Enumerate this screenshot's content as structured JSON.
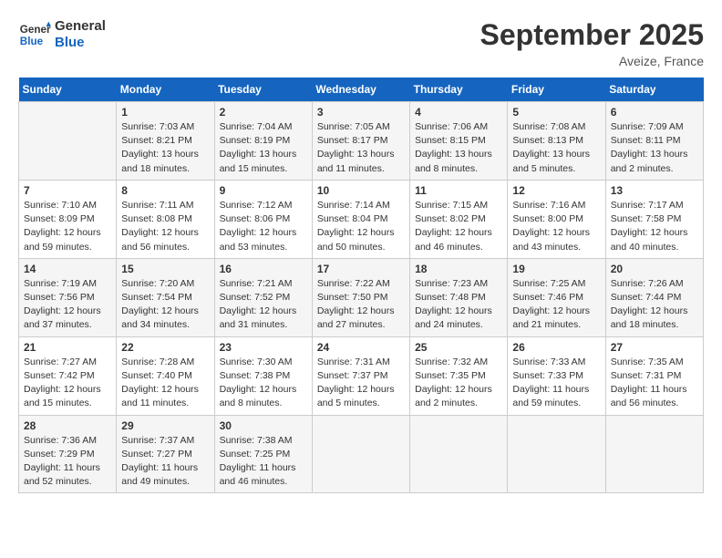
{
  "logo": {
    "line1": "General",
    "line2": "Blue"
  },
  "title": "September 2025",
  "location": "Aveize, France",
  "days_of_week": [
    "Sunday",
    "Monday",
    "Tuesday",
    "Wednesday",
    "Thursday",
    "Friday",
    "Saturday"
  ],
  "weeks": [
    [
      {
        "day": "",
        "info": ""
      },
      {
        "day": "1",
        "info": "Sunrise: 7:03 AM\nSunset: 8:21 PM\nDaylight: 13 hours\nand 18 minutes."
      },
      {
        "day": "2",
        "info": "Sunrise: 7:04 AM\nSunset: 8:19 PM\nDaylight: 13 hours\nand 15 minutes."
      },
      {
        "day": "3",
        "info": "Sunrise: 7:05 AM\nSunset: 8:17 PM\nDaylight: 13 hours\nand 11 minutes."
      },
      {
        "day": "4",
        "info": "Sunrise: 7:06 AM\nSunset: 8:15 PM\nDaylight: 13 hours\nand 8 minutes."
      },
      {
        "day": "5",
        "info": "Sunrise: 7:08 AM\nSunset: 8:13 PM\nDaylight: 13 hours\nand 5 minutes."
      },
      {
        "day": "6",
        "info": "Sunrise: 7:09 AM\nSunset: 8:11 PM\nDaylight: 13 hours\nand 2 minutes."
      }
    ],
    [
      {
        "day": "7",
        "info": "Sunrise: 7:10 AM\nSunset: 8:09 PM\nDaylight: 12 hours\nand 59 minutes."
      },
      {
        "day": "8",
        "info": "Sunrise: 7:11 AM\nSunset: 8:08 PM\nDaylight: 12 hours\nand 56 minutes."
      },
      {
        "day": "9",
        "info": "Sunrise: 7:12 AM\nSunset: 8:06 PM\nDaylight: 12 hours\nand 53 minutes."
      },
      {
        "day": "10",
        "info": "Sunrise: 7:14 AM\nSunset: 8:04 PM\nDaylight: 12 hours\nand 50 minutes."
      },
      {
        "day": "11",
        "info": "Sunrise: 7:15 AM\nSunset: 8:02 PM\nDaylight: 12 hours\nand 46 minutes."
      },
      {
        "day": "12",
        "info": "Sunrise: 7:16 AM\nSunset: 8:00 PM\nDaylight: 12 hours\nand 43 minutes."
      },
      {
        "day": "13",
        "info": "Sunrise: 7:17 AM\nSunset: 7:58 PM\nDaylight: 12 hours\nand 40 minutes."
      }
    ],
    [
      {
        "day": "14",
        "info": "Sunrise: 7:19 AM\nSunset: 7:56 PM\nDaylight: 12 hours\nand 37 minutes."
      },
      {
        "day": "15",
        "info": "Sunrise: 7:20 AM\nSunset: 7:54 PM\nDaylight: 12 hours\nand 34 minutes."
      },
      {
        "day": "16",
        "info": "Sunrise: 7:21 AM\nSunset: 7:52 PM\nDaylight: 12 hours\nand 31 minutes."
      },
      {
        "day": "17",
        "info": "Sunrise: 7:22 AM\nSunset: 7:50 PM\nDaylight: 12 hours\nand 27 minutes."
      },
      {
        "day": "18",
        "info": "Sunrise: 7:23 AM\nSunset: 7:48 PM\nDaylight: 12 hours\nand 24 minutes."
      },
      {
        "day": "19",
        "info": "Sunrise: 7:25 AM\nSunset: 7:46 PM\nDaylight: 12 hours\nand 21 minutes."
      },
      {
        "day": "20",
        "info": "Sunrise: 7:26 AM\nSunset: 7:44 PM\nDaylight: 12 hours\nand 18 minutes."
      }
    ],
    [
      {
        "day": "21",
        "info": "Sunrise: 7:27 AM\nSunset: 7:42 PM\nDaylight: 12 hours\nand 15 minutes."
      },
      {
        "day": "22",
        "info": "Sunrise: 7:28 AM\nSunset: 7:40 PM\nDaylight: 12 hours\nand 11 minutes."
      },
      {
        "day": "23",
        "info": "Sunrise: 7:30 AM\nSunset: 7:38 PM\nDaylight: 12 hours\nand 8 minutes."
      },
      {
        "day": "24",
        "info": "Sunrise: 7:31 AM\nSunset: 7:37 PM\nDaylight: 12 hours\nand 5 minutes."
      },
      {
        "day": "25",
        "info": "Sunrise: 7:32 AM\nSunset: 7:35 PM\nDaylight: 12 hours\nand 2 minutes."
      },
      {
        "day": "26",
        "info": "Sunrise: 7:33 AM\nSunset: 7:33 PM\nDaylight: 11 hours\nand 59 minutes."
      },
      {
        "day": "27",
        "info": "Sunrise: 7:35 AM\nSunset: 7:31 PM\nDaylight: 11 hours\nand 56 minutes."
      }
    ],
    [
      {
        "day": "28",
        "info": "Sunrise: 7:36 AM\nSunset: 7:29 PM\nDaylight: 11 hours\nand 52 minutes."
      },
      {
        "day": "29",
        "info": "Sunrise: 7:37 AM\nSunset: 7:27 PM\nDaylight: 11 hours\nand 49 minutes."
      },
      {
        "day": "30",
        "info": "Sunrise: 7:38 AM\nSunset: 7:25 PM\nDaylight: 11 hours\nand 46 minutes."
      },
      {
        "day": "",
        "info": ""
      },
      {
        "day": "",
        "info": ""
      },
      {
        "day": "",
        "info": ""
      },
      {
        "day": "",
        "info": ""
      }
    ]
  ]
}
